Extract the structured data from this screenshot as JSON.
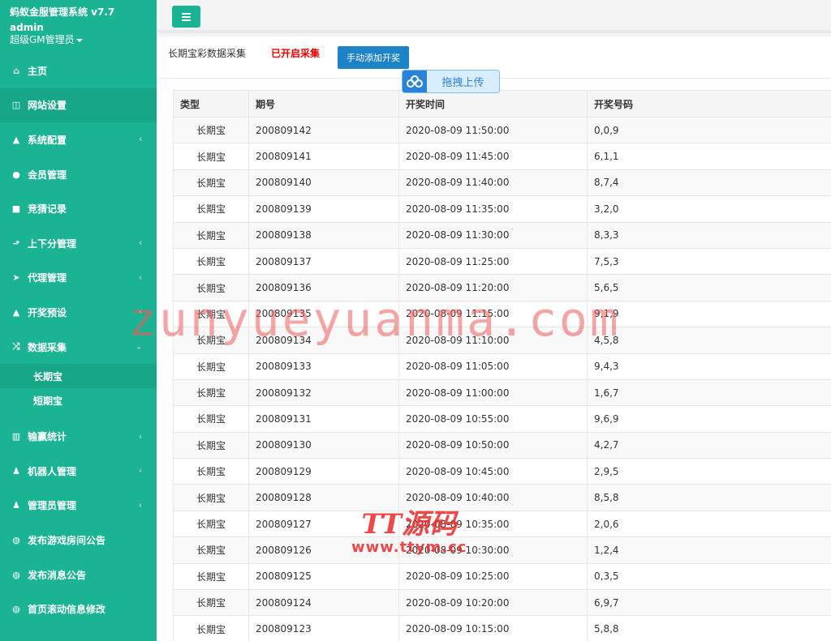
{
  "sidebar": {
    "brand_title": "蚂蚁金服管理系统 v7.7",
    "user": "admin",
    "role": "超级GM管理员",
    "items": [
      {
        "label": "主页",
        "icon": "home-icon",
        "glyph": "⌂",
        "has_arrow": false
      },
      {
        "label": "网站设置",
        "icon": "columns-icon",
        "glyph": "◫",
        "has_arrow": false
      },
      {
        "label": "系统配置",
        "icon": "flask-icon",
        "glyph": "▲",
        "has_arrow": true
      },
      {
        "label": "会员管理",
        "icon": "user-icon",
        "glyph": "●",
        "has_arrow": false
      },
      {
        "label": "竞猜记录",
        "icon": "car-icon",
        "glyph": "■",
        "has_arrow": false
      },
      {
        "label": "上下分管理",
        "icon": "level-up-icon",
        "glyph": "⬏",
        "has_arrow": true
      },
      {
        "label": "代理管理",
        "icon": "paper-plane-icon",
        "glyph": "➤",
        "has_arrow": true
      },
      {
        "label": "开奖预设",
        "icon": "flask-icon",
        "glyph": "▲",
        "has_arrow": true
      },
      {
        "label": "数据采集",
        "icon": "shuffle-icon",
        "glyph": "⤮",
        "has_arrow": true,
        "expanded": true
      }
    ],
    "sub_items": [
      {
        "label": "长期宝"
      },
      {
        "label": "短期宝"
      }
    ],
    "items_after": [
      {
        "label": "输赢统计",
        "icon": "bar-chart-icon",
        "glyph": "▥",
        "has_arrow": true
      },
      {
        "label": "机器人管理",
        "icon": "android-icon",
        "glyph": "♟",
        "has_arrow": true
      },
      {
        "label": "管理员管理",
        "icon": "person-icon",
        "glyph": "♟",
        "has_arrow": true
      },
      {
        "label": "发布游戏房间公告",
        "icon": "comment-icon",
        "glyph": "◍",
        "has_arrow": false
      },
      {
        "label": "发布消息公告",
        "icon": "comment-icon",
        "glyph": "◍",
        "has_arrow": false
      },
      {
        "label": "首页滚动信息修改",
        "icon": "comment-icon",
        "glyph": "◍",
        "has_arrow": false
      }
    ]
  },
  "header": {
    "title": "长期宝彩数据采集",
    "status": "已开启采集",
    "add_button": "手动添加开奖",
    "upload_button": "拖拽上传"
  },
  "table": {
    "columns": [
      "类型",
      "期号",
      "开奖时间",
      "开奖号码"
    ],
    "rows": [
      [
        "长期宝",
        "200809142",
        "2020-08-09 11:50:00",
        "0,0,9"
      ],
      [
        "长期宝",
        "200809141",
        "2020-08-09 11:45:00",
        "6,1,1"
      ],
      [
        "长期宝",
        "200809140",
        "2020-08-09 11:40:00",
        "8,7,4"
      ],
      [
        "长期宝",
        "200809139",
        "2020-08-09 11:35:00",
        "3,2,0"
      ],
      [
        "长期宝",
        "200809138",
        "2020-08-09 11:30:00",
        "8,3,3"
      ],
      [
        "长期宝",
        "200809137",
        "2020-08-09 11:25:00",
        "7,5,3"
      ],
      [
        "长期宝",
        "200809136",
        "2020-08-09 11:20:00",
        "5,6,5"
      ],
      [
        "长期宝",
        "200809135",
        "2020-08-09 11:15:00",
        "9,1,9"
      ],
      [
        "长期宝",
        "200809134",
        "2020-08-09 11:10:00",
        "4,5,8"
      ],
      [
        "长期宝",
        "200809133",
        "2020-08-09 11:05:00",
        "9,4,3"
      ],
      [
        "长期宝",
        "200809132",
        "2020-08-09 11:00:00",
        "1,6,7"
      ],
      [
        "长期宝",
        "200809131",
        "2020-08-09 10:55:00",
        "9,6,9"
      ],
      [
        "长期宝",
        "200809130",
        "2020-08-09 10:50:00",
        "4,2,7"
      ],
      [
        "长期宝",
        "200809129",
        "2020-08-09 10:45:00",
        "2,9,5"
      ],
      [
        "长期宝",
        "200809128",
        "2020-08-09 10:40:00",
        "8,5,8"
      ],
      [
        "长期宝",
        "200809127",
        "2020-08-09 10:35:00",
        "2,0,6"
      ],
      [
        "长期宝",
        "200809126",
        "2020-08-09 10:30:00",
        "1,2,4"
      ],
      [
        "长期宝",
        "200809125",
        "2020-08-09 10:25:00",
        "0,3,5"
      ],
      [
        "长期宝",
        "200809124",
        "2020-08-09 10:20:00",
        "6,9,7"
      ],
      [
        "长期宝",
        "200809123",
        "2020-08-09 10:15:00",
        "5,8,8"
      ]
    ]
  },
  "watermarks": {
    "main": "zunyueyuanma.com",
    "logo_text": "TT源码",
    "logo_url": "www.ttym.cc"
  },
  "colors": {
    "sidebar_bg": "#1ab394",
    "active_bg": "#18a689",
    "primary_button": "#1c84c6",
    "status_red": "#ee0000"
  }
}
